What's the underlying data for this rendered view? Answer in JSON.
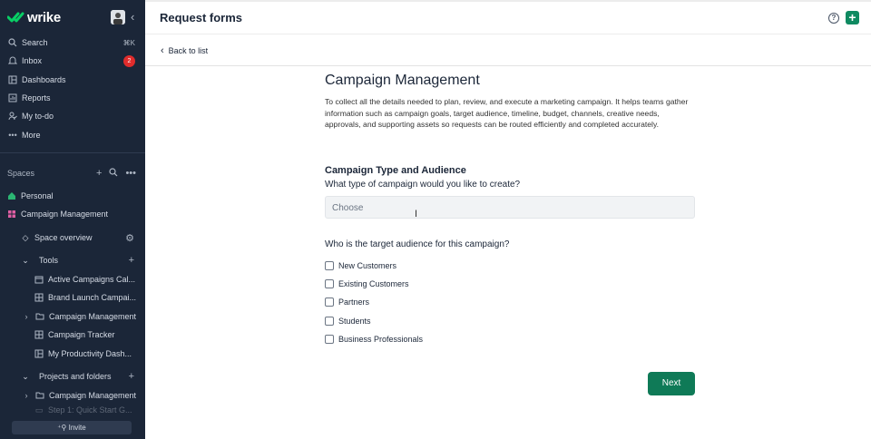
{
  "app": {
    "brand": "wrike",
    "search_label": "Search",
    "search_shortcut": "⌘K",
    "inbox_label": "Inbox",
    "inbox_count": "2",
    "dashboards_label": "Dashboards",
    "reports_label": "Reports",
    "todo_label": "My to-do",
    "more_label": "More"
  },
  "spaces": {
    "heading": "Spaces",
    "personal": "Personal",
    "campaign": "Campaign Management",
    "space_overview": "Space overview",
    "tools": "Tools",
    "tool_items": [
      "Active Campaigns Cal...",
      "Brand Launch Campai...",
      "Campaign Management",
      "Campaign Tracker",
      "My Productivity Dash..."
    ],
    "projects_heading": "Projects and folders",
    "project_items": [
      "Campaign Management",
      "Step 1: Quick Start G..."
    ],
    "invite_label": "Invite"
  },
  "header": {
    "title": "Request forms",
    "help": "?",
    "add": "+"
  },
  "subbar": {
    "back_label": "Back to list"
  },
  "form": {
    "title": "Campaign Management",
    "description": "To collect all the details needed to plan, review, and execute a marketing campaign. It helps teams gather information such as campaign goals, target audience, timeline, budget, channels, creative needs, approvals, and supporting assets so requests can be routed efficiently and completed accurately.",
    "section_title": "Campaign Type and Audience",
    "q1": "What type of campaign would you like to create?",
    "q1_placeholder": "Choose",
    "q2": "Who is the target audience for this campaign?",
    "audience_options": [
      "New Customers",
      "Existing Customers",
      "Partners",
      "Students",
      "Business Professionals"
    ],
    "next_label": "Next"
  },
  "colors": {
    "sidebar_bg": "#1b2638",
    "accent": "#0f7a57",
    "badge": "#e02c2c"
  }
}
